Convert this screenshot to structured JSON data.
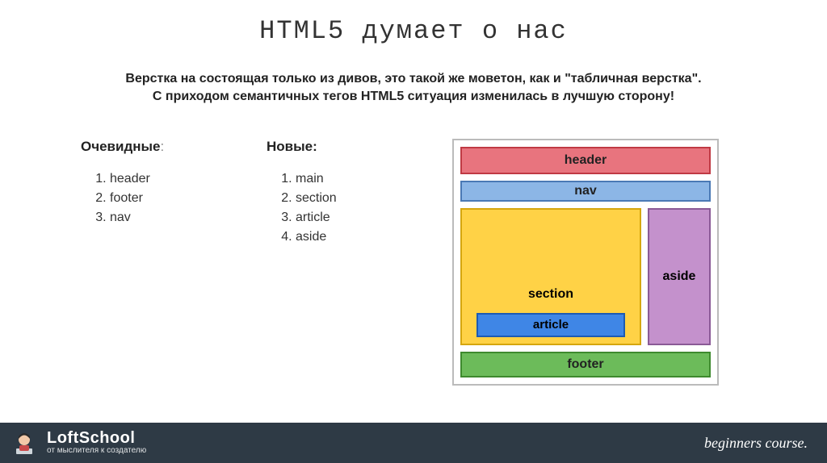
{
  "title": "HTML5 думает о нас",
  "subtitle_line1": "Верстка на состоящая только из дивов, это такой же моветон, как и \"табличная верстка\".",
  "subtitle_line2": "С приходом семантичных тегов HTML5 ситуация изменилась в лучшую сторону!",
  "obvious": {
    "heading": "Очевидные",
    "colon": ":",
    "items": [
      "header",
      "footer",
      "nav"
    ]
  },
  "new": {
    "heading": "Новые:",
    "items": [
      "main",
      "section",
      "article",
      "aside"
    ]
  },
  "diagram": {
    "header": "header",
    "nav": "nav",
    "section": "section",
    "article": "article",
    "aside": "aside",
    "footer": "footer"
  },
  "footer": {
    "brand": "LoftSchool",
    "tagline": "от мыслителя к создателю",
    "course": "beginners course."
  }
}
